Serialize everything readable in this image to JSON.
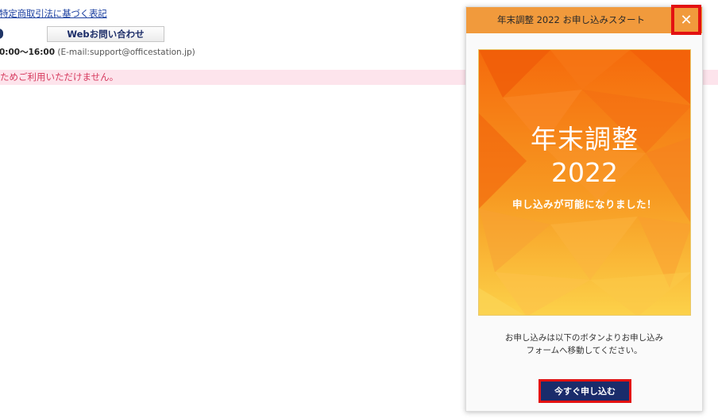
{
  "page": {
    "legal_link": "特定商取引法に基づく表記",
    "web_inquiry_label": "Webお問い合わせ",
    "hours": "0:00〜16:00",
    "email": "(E-mail:support@officestation.jp)",
    "notice_text": "ためご利用いただけません。"
  },
  "modal": {
    "title": "年末調整 2022 お申し込みスタート",
    "close_glyph": "✕",
    "banner": {
      "heading": "年末調整",
      "year": "2022",
      "subtitle": "申し込みが可能になりました！"
    },
    "instructions_line1": "お申し込みは以下のボタンよりお申し込み",
    "instructions_line2": "フォームへ移動してください。",
    "apply_label": "今すぐ申し込む"
  },
  "colors": {
    "header": "#f19a3c",
    "highlight": "#e31212",
    "apply_button": "#1a2c6b",
    "notice_background": "#fde4ec",
    "notice_text": "#d63a5e"
  }
}
